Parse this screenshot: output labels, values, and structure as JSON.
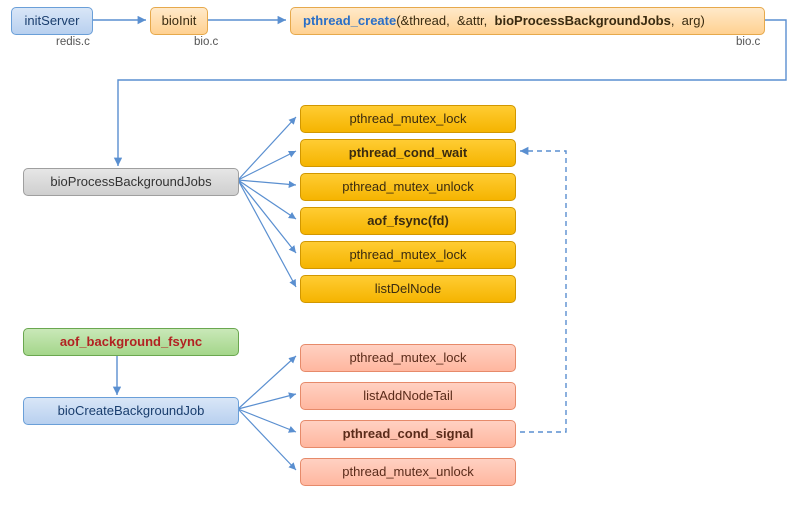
{
  "nodes": {
    "initServer": {
      "label": "initServer",
      "file": "redis.c"
    },
    "bioInit": {
      "label": "bioInit",
      "file": "bio.c"
    },
    "pthreadCreate": {
      "fn": "pthread_create",
      "arg1": "(&thread,",
      "arg2": "&attr,",
      "arg3": "bioProcessBackgroundJobs",
      "arg4": ",",
      "arg5": "arg)",
      "file": "bio.c"
    },
    "bioProcess": {
      "label": "bioProcessBackgroundJobs"
    },
    "bioList": {
      "i0": "pthread_mutex_lock",
      "i1": "pthread_cond_wait",
      "i2": "pthread_mutex_unlock",
      "i3": "aof_fsync(fd)",
      "i4": "pthread_mutex_lock",
      "i5": "listDelNode"
    },
    "aofBgFsync": {
      "label": "aof_background_fsync"
    },
    "bioCreate": {
      "label": "bioCreateBackgroundJob"
    },
    "createList": {
      "i0": "pthread_mutex_lock",
      "i1": "listAddNodeTail",
      "i2": "pthread_cond_signal",
      "i3": "pthread_mutex_unlock"
    }
  }
}
